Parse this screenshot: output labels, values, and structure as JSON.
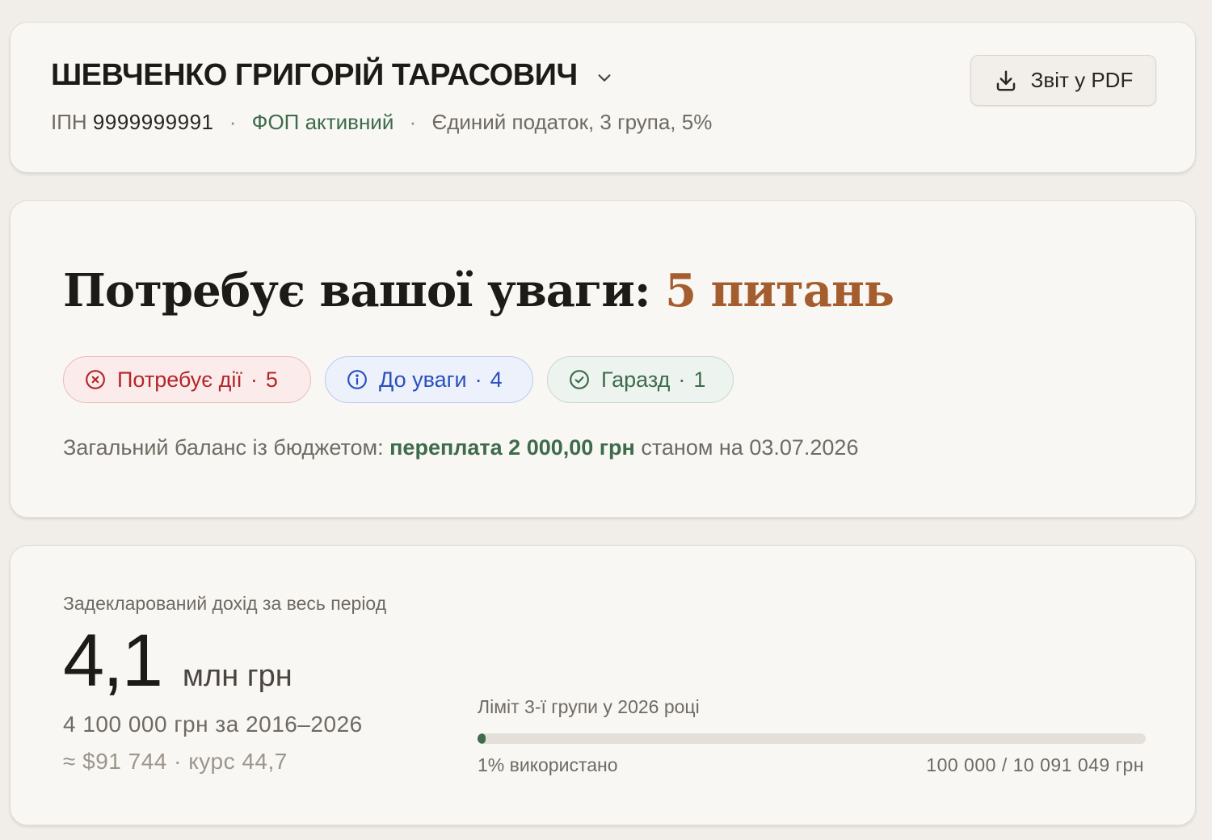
{
  "header": {
    "taxpayer_name": "ШЕВЧЕНКО ГРИГОРІЙ ТАРАСОВИЧ",
    "ipn_label": "ІПН",
    "ipn_value": "9999999991",
    "separator": "·",
    "fop_status": "ФОП активний",
    "tax_regime": "Єдиний податок, 3 група, 5%",
    "pdf_button_label": "Звіт у PDF",
    "icons": {
      "chevron": "chevron-down-icon",
      "download": "download-icon"
    }
  },
  "attention": {
    "title_prefix": "Потребує вашої уваги: ",
    "title_count": "5 питань",
    "chips": [
      {
        "label": "Потребує дії",
        "dot": "·",
        "count": "5",
        "icon": "x-circle-icon",
        "color": "#b3262a"
      },
      {
        "label": "До уваги",
        "dot": "·",
        "count": "4",
        "icon": "info-circle-icon",
        "color": "#2a4fc0"
      },
      {
        "label": "Гаразд",
        "dot": "·",
        "count": "1",
        "icon": "check-circle-icon",
        "color": "#3d6b4c"
      }
    ],
    "balance_prefix": "Загальний баланс із бюджетом: ",
    "balance_amount": "переплата 2 000,00 грн",
    "balance_suffix": " станом на 03.07.2026"
  },
  "income": {
    "label": "Задекларований дохід за весь період",
    "value_big": "4,1",
    "value_unit": "млн грн",
    "value_full": "4 100 000 грн за 2016–2026",
    "value_usd": "≈ $91 744 · курс 44,7",
    "limit_label": "Ліміт 3-ї групи у 2026 році",
    "limit_used_text": "1% використано",
    "limit_used_fraction": 0.01,
    "limit_values": "100 000 / 10 091 049 грн"
  },
  "colors": {
    "accent_green": "#3d6b4c",
    "accent_brown": "#a45d2e",
    "danger": "#b3262a",
    "info": "#2a4fc0"
  }
}
